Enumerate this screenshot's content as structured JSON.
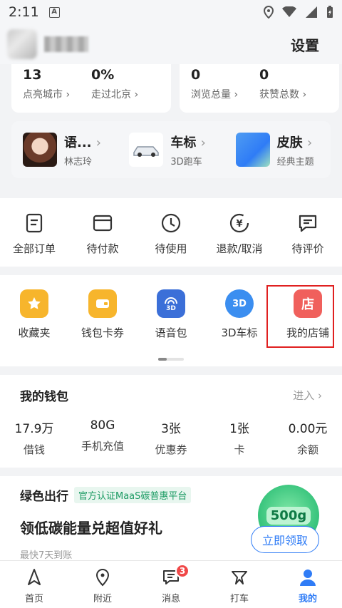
{
  "status_bar": {
    "time": "2:11",
    "notification_letter": "A"
  },
  "header": {
    "settings_label": "设置"
  },
  "stats": [
    {
      "value": "13",
      "label": "点亮城市 ›"
    },
    {
      "value": "0%",
      "label": "走过北京 ›"
    },
    {
      "value": "0",
      "label": "浏览总量 ›"
    },
    {
      "value": "0",
      "label": "获赞总数 ›"
    }
  ],
  "features": [
    {
      "title": "语...",
      "subtitle": "林志玲"
    },
    {
      "title": "车标",
      "subtitle": "3D跑车"
    },
    {
      "title": "皮肤",
      "subtitle": "经典主题"
    }
  ],
  "orders": [
    {
      "label": "全部订单"
    },
    {
      "label": "待付款"
    },
    {
      "label": "待使用"
    },
    {
      "label": "退款/取消"
    },
    {
      "label": "待评价"
    }
  ],
  "tools": [
    {
      "label": "收藏夹",
      "icon": "star-icon",
      "color": "#f7b52c"
    },
    {
      "label": "钱包卡券",
      "icon": "wallet-icon",
      "color": "#f7b52c"
    },
    {
      "label": "语音包",
      "icon": "voice-pack-icon",
      "color": "#3b6fd8"
    },
    {
      "label": "3D车标",
      "icon": "3d-icon",
      "color": "#3b8ef0"
    },
    {
      "label": "我的店铺",
      "icon": "shop-icon",
      "color": "#f0605c",
      "glyph": "店"
    }
  ],
  "tool_badges": {
    "voice": "3D",
    "car": "3D"
  },
  "wallet": {
    "title": "我的钱包",
    "enter_label": "进入 ›",
    "items": [
      {
        "value": "17.9万",
        "label": "借钱"
      },
      {
        "value": "80G",
        "label": "手机充值"
      },
      {
        "value": "3张",
        "label": "优惠券"
      },
      {
        "value": "1张",
        "label": "卡"
      },
      {
        "value": "0.00元",
        "label": "余额"
      }
    ]
  },
  "green": {
    "title": "绿色出行",
    "tag": "官方认证MaaS碳普惠平台",
    "headline": "领低碳能量兑超值好礼",
    "sub": "最快7天到账",
    "coin_label": "500g",
    "claim_label": "立即领取"
  },
  "tabbar": [
    {
      "label": "首页",
      "icon": "home-nav-icon"
    },
    {
      "label": "附近",
      "icon": "location-pin-icon"
    },
    {
      "label": "消息",
      "icon": "message-icon",
      "badge": "3"
    },
    {
      "label": "打车",
      "icon": "taxi-icon"
    },
    {
      "label": "我的",
      "icon": "profile-icon",
      "active": true
    }
  ],
  "colors": {
    "accent": "#2f7cf6",
    "highlight": "#e02020",
    "badge": "#f04848"
  }
}
